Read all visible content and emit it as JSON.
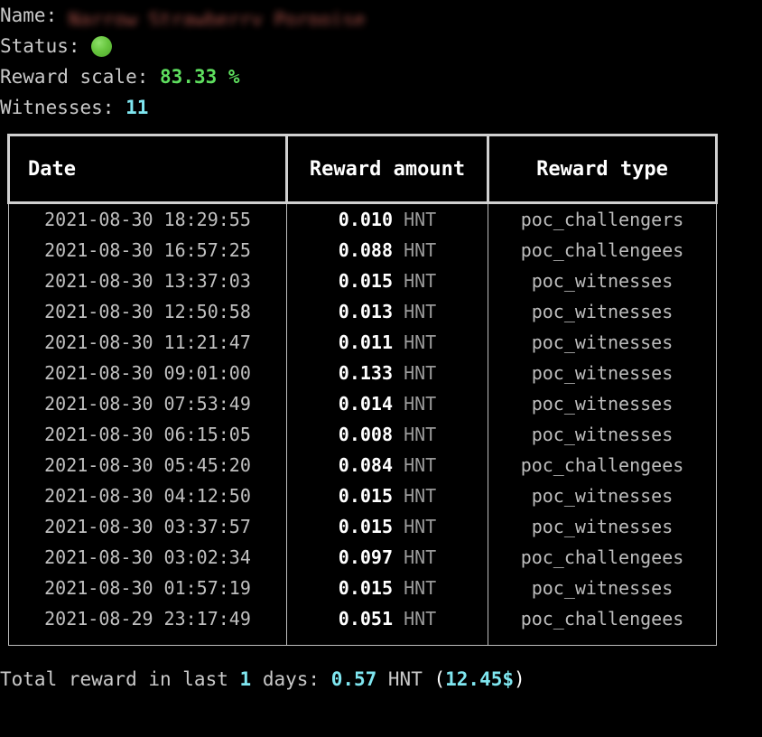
{
  "info": {
    "name_label": "Name:",
    "name_value": "Narrow Strawberry Porpoise",
    "name_redacted": true,
    "status_label": "Status:",
    "status_icon": "green-circle",
    "status_color": "#5ec63c",
    "reward_scale_label": "Reward scale:",
    "reward_scale_value": "83.33 %",
    "witnesses_label": "Witnesses:",
    "witnesses_value": "11"
  },
  "table": {
    "headers": {
      "date": "Date",
      "amount": "Reward amount",
      "type": "Reward type"
    },
    "unit": "HNT",
    "rows": [
      {
        "date": "2021-08-30 18:29:55",
        "amount": "0.010",
        "unit": "HNT",
        "type": "poc_challengers"
      },
      {
        "date": "2021-08-30 16:57:25",
        "amount": "0.088",
        "unit": "HNT",
        "type": "poc_challengees"
      },
      {
        "date": "2021-08-30 13:37:03",
        "amount": "0.015",
        "unit": "HNT",
        "type": "poc_witnesses"
      },
      {
        "date": "2021-08-30 12:50:58",
        "amount": "0.013",
        "unit": "HNT",
        "type": "poc_witnesses"
      },
      {
        "date": "2021-08-30 11:21:47",
        "amount": "0.011",
        "unit": "HNT",
        "type": "poc_witnesses"
      },
      {
        "date": "2021-08-30 09:01:00",
        "amount": "0.133",
        "unit": "HNT",
        "type": "poc_witnesses"
      },
      {
        "date": "2021-08-30 07:53:49",
        "amount": "0.014",
        "unit": "HNT",
        "type": "poc_witnesses"
      },
      {
        "date": "2021-08-30 06:15:05",
        "amount": "0.008",
        "unit": "HNT",
        "type": "poc_witnesses"
      },
      {
        "date": "2021-08-30 05:45:20",
        "amount": "0.084",
        "unit": "HNT",
        "type": "poc_challengees"
      },
      {
        "date": "2021-08-30 04:12:50",
        "amount": "0.015",
        "unit": "HNT",
        "type": "poc_witnesses"
      },
      {
        "date": "2021-08-30 03:37:57",
        "amount": "0.015",
        "unit": "HNT",
        "type": "poc_witnesses"
      },
      {
        "date": "2021-08-30 03:02:34",
        "amount": "0.097",
        "unit": "HNT",
        "type": "poc_challengees"
      },
      {
        "date": "2021-08-30 01:57:19",
        "amount": "0.015",
        "unit": "HNT",
        "type": "poc_witnesses"
      },
      {
        "date": "2021-08-29 23:17:49",
        "amount": "0.051",
        "unit": "HNT",
        "type": "poc_challengees"
      }
    ]
  },
  "footer": {
    "prefix": "Total reward in last ",
    "days": "1",
    "middle": " days: ",
    "total_hnt": "0.57",
    "unit": " HNT ",
    "open_paren": "(",
    "usd": "12.45$",
    "close_paren": ")"
  },
  "colors": {
    "background": "#000000",
    "label": "#c9c9c9",
    "green": "#5ede5e",
    "cyan": "#7fe6f0",
    "value_white": "#ffffff",
    "unit_gray": "#9a9a9a",
    "border": "#d0d0d0",
    "redaction": "#b8574e"
  }
}
